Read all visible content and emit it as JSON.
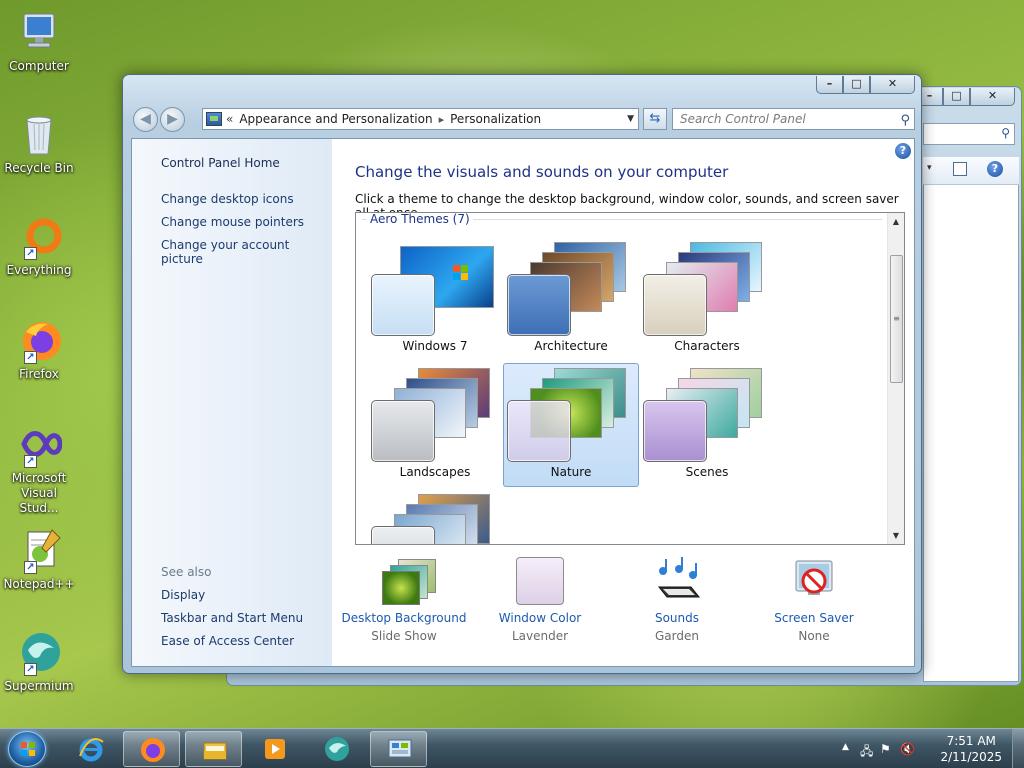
{
  "desktop": {
    "icons": [
      {
        "label": "Computer"
      },
      {
        "label": "Recycle Bin"
      },
      {
        "label": "Everything"
      },
      {
        "label": "Firefox"
      },
      {
        "label_line1": "Microsoft",
        "label_line2": "Visual Stud..."
      },
      {
        "label": "Notepad++"
      },
      {
        "label": "Supermium"
      }
    ]
  },
  "window": {
    "breadcrumb": {
      "overflow": "«",
      "items": [
        "Appearance and Personalization",
        "Personalization"
      ],
      "separator": "▸"
    },
    "search_placeholder": "Search Control Panel",
    "left_pane": {
      "home": "Control Panel Home",
      "tasks": [
        "Change desktop icons",
        "Change mouse pointers",
        "Change your account picture"
      ],
      "see_also_heading": "See also",
      "see_also": [
        "Display",
        "Taskbar and Start Menu",
        "Ease of Access Center"
      ]
    },
    "title": "Change the visuals and sounds on your computer",
    "description": "Click a theme to change the desktop background, window color, sounds, and screen saver all at once.",
    "themes_group": "Aero Themes (7)",
    "themes": [
      {
        "name": "Windows 7",
        "selected": false
      },
      {
        "name": "Architecture",
        "selected": false
      },
      {
        "name": "Characters",
        "selected": false
      },
      {
        "name": "Landscapes",
        "selected": false
      },
      {
        "name": "Nature",
        "selected": true
      },
      {
        "name": "Scenes",
        "selected": false
      },
      {
        "name": "",
        "selected": false
      }
    ],
    "bottom": [
      {
        "link": "Desktop Background",
        "value": "Slide Show"
      },
      {
        "link": "Window Color",
        "value": "Lavender"
      },
      {
        "link": "Sounds",
        "value": "Garden"
      },
      {
        "link": "Screen Saver",
        "value": "None"
      }
    ],
    "help_label": "?"
  },
  "taskbar": {
    "clock_time": "7:51 AM",
    "clock_date": "2/11/2025",
    "pinned": [
      "start-orb",
      "internet-explorer-icon",
      "firefox-icon",
      "file-explorer-icon",
      "media-player-icon",
      "supermium-icon",
      "control-panel-icon"
    ]
  },
  "colors": {
    "title_blue": "#1e3287",
    "link_blue": "#1c5ab0",
    "selection": "#c1dcf6"
  }
}
